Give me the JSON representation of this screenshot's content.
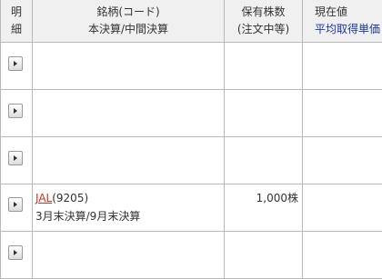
{
  "header": {
    "col1_line1": "明",
    "col1_line2": "細",
    "col2_line1": "銘柄(コード)",
    "col2_line2": "本決算/中間決算",
    "col3_line1": "保有株数",
    "col3_line2": "(注文中等)",
    "col4_line1": "現在値",
    "col4_line2": "平均取得単価"
  },
  "rows": [
    {},
    {},
    {},
    {
      "name": "JAL",
      "code": "(9205)",
      "fiscal": "3月末決算/9月末決算",
      "shares": "1,000株"
    },
    {}
  ],
  "colors": {
    "link": "#c0392b",
    "avg_price_header": "#1a3a9c",
    "header_bg": "#f0f0f0",
    "grid": "#b8b8b8"
  },
  "icons": {
    "detail_button": "triangle-right-icon"
  }
}
